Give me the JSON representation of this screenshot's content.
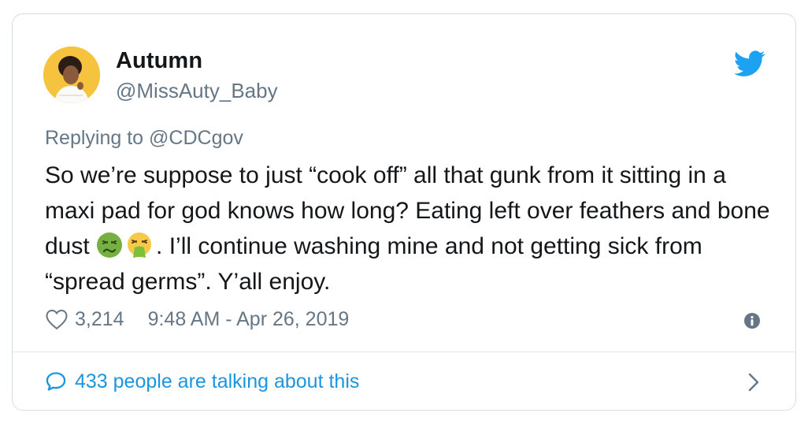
{
  "author": {
    "display_name": "Autumn",
    "handle": "@MissAuty_Baby"
  },
  "reply": {
    "prefix": "Replying to",
    "mention": "@CDCgov"
  },
  "tweet": {
    "text_part1": "So we’re suppose to just “cook off” all that gunk from it sitting in a maxi pad for god knows how long? Eating left over feathers and bone dust ",
    "emoji_1": "nauseated-face",
    "emoji_2": "face-vomiting",
    "text_part2": ". I’ll continue washing mine and not getting sick from “spread germs”. Y’all enjoy."
  },
  "meta": {
    "likes": "3,214",
    "timestamp": "9:48 AM - Apr 26, 2019"
  },
  "conversation": {
    "label": "433 people are talking about this"
  },
  "icons": {
    "brand": "twitter-bird-icon",
    "like": "heart-icon",
    "info": "info-icon",
    "reply": "speech-bubble-icon",
    "chevron": "chevron-right-icon"
  },
  "colors": {
    "twitter_blue": "#1da1f2",
    "link_blue": "#1b95e0",
    "secondary_text": "#657786",
    "primary_text": "#14171a",
    "border": "#d6dde3"
  }
}
